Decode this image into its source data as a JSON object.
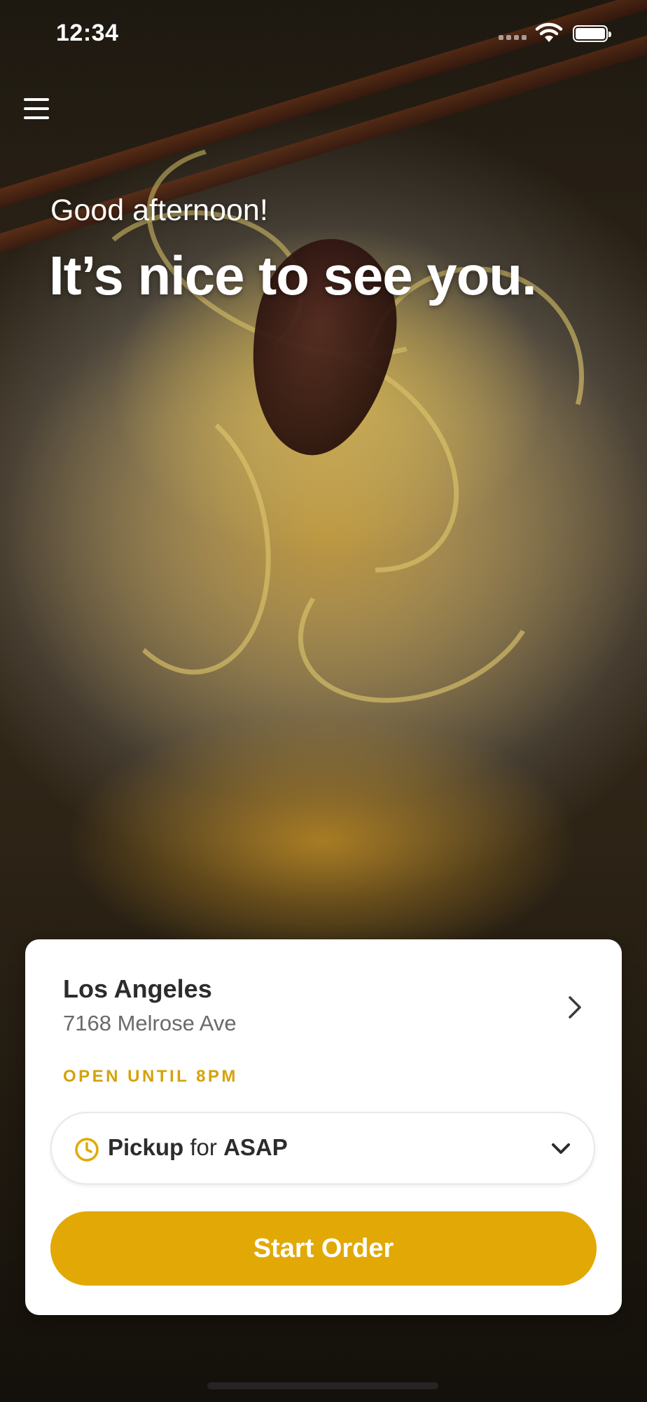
{
  "status_bar": {
    "time": "12:34"
  },
  "hero": {
    "greeting": "Good afternoon!",
    "headline": "It’s nice to see you."
  },
  "location_card": {
    "name": "Los Angeles",
    "address": "7168 Melrose Ave",
    "hours": "OPEN UNTIL 8PM",
    "order_type": {
      "mode": "Pickup",
      "connector": "for",
      "time": "ASAP"
    },
    "start_button_label": "Start Order"
  },
  "icons": {
    "menu": "hamburger-menu-icon",
    "chevron_right": "chevron-right-icon",
    "clock": "clock-icon",
    "chevron_down": "chevron-down-icon"
  },
  "colors": {
    "accent": "#e2a906",
    "hours_text": "#d4a20b",
    "card_background": "#ffffff",
    "title_text": "#2c2c2c",
    "secondary_text": "#6a6a6a"
  }
}
